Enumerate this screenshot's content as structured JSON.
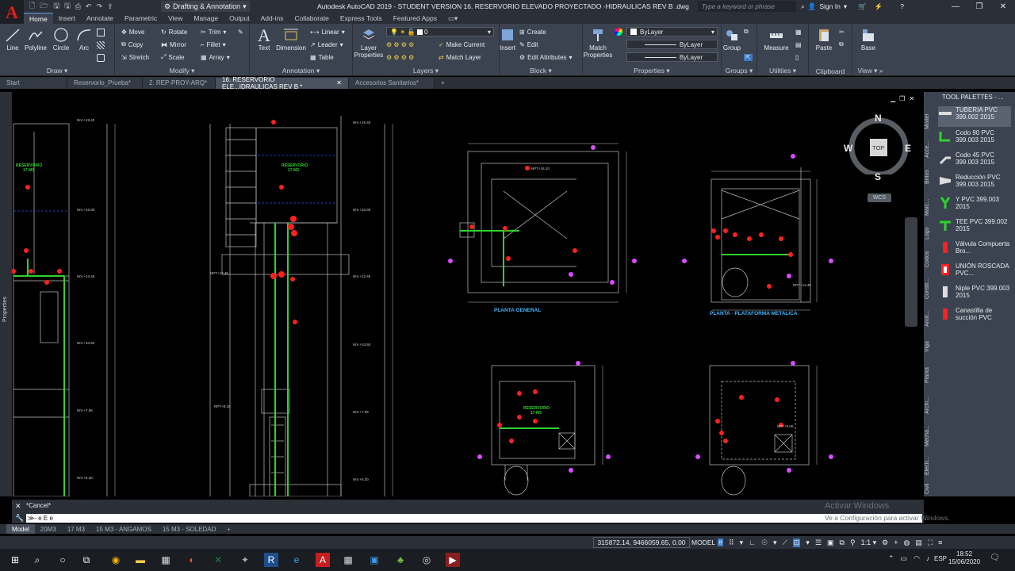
{
  "app": {
    "title": "Autodesk AutoCAD 2019 - STUDENT VERSION    16. RESERVORIO ELEVADO PROYECTADO -HIDRAULICAS REV B .dwg",
    "workspace": "Drafting & Annotation",
    "search_placeholder": "Type a keyword or phrase",
    "sign_in": "Sign In",
    "logo_letter": "A"
  },
  "menu_tabs": [
    "Home",
    "Insert",
    "Annotate",
    "Parametric",
    "View",
    "Manage",
    "Output",
    "Add-ins",
    "Collaborate",
    "Express Tools",
    "Featured Apps"
  ],
  "ribbon": {
    "draw": {
      "title": "Draw",
      "line": "Line",
      "polyline": "Polyline",
      "circle": "Circle",
      "arc": "Arc"
    },
    "modify": {
      "title": "Modify",
      "move": "Move",
      "rotate": "Rotate",
      "trim": "Trim",
      "copy": "Copy",
      "mirror": "Mirror",
      "fillet": "Fillet",
      "stretch": "Stretch",
      "scale": "Scale",
      "array": "Array"
    },
    "annotation": {
      "title": "Annotation",
      "text": "Text",
      "dimension": "Dimension",
      "linear": "Linear",
      "leader": "Leader",
      "table": "Table"
    },
    "layers": {
      "title": "Layers",
      "layer_properties": "Layer Properties",
      "current_layer": "0",
      "make_current": "Make Current",
      "match_layer": "Match Layer"
    },
    "block": {
      "title": "Block",
      "insert": "Insert",
      "create": "Create",
      "edit": "Edit",
      "edit_attributes": "Edit Attributes"
    },
    "properties": {
      "title": "Properties",
      "match_properties": "Match Properties",
      "bylayer1": "ByLayer",
      "bylayer2": "ByLayer",
      "bylayer3": "ByLayer"
    },
    "groups": {
      "title": "Groups",
      "group": "Group"
    },
    "utilities": {
      "title": "Utilities",
      "measure": "Measure"
    },
    "clipboard": {
      "title": "Clipboard",
      "paste": "Paste"
    },
    "view": {
      "title": "View",
      "base": "Base"
    }
  },
  "file_tabs": [
    "Start",
    "Reservorio_Prueba*",
    "2. REP-PROY-ARQ*",
    "16. RESERVORIO ELE...IDRAULICAS REV B *",
    "Accesorios Sanitarios*"
  ],
  "properties_label": "Properties",
  "viewcube": {
    "n": "N",
    "s": "S",
    "e": "E",
    "w": "W",
    "top": "TOP",
    "wcs": "WCS"
  },
  "drawing": {
    "planta_general": "PLANTA GENERAL",
    "planta_plataforma": "PLANTA - PLATAFORMA METALICA",
    "reservorio1": "RESERVORIO",
    "reservorio1_vol": "17 M3",
    "reservorio2": "RESERVORIO",
    "reservorio2_vol": "17 M3",
    "reservorio3": "RESERVORIO",
    "reservorio3_vol": "17 M3"
  },
  "tool_palette": {
    "title": "TOOL PALETTES - ...",
    "items": [
      "TUBERIA PVC 399.002 2015",
      "Codo 90 PVC 399.003 2015",
      "Codo 45 PVC 399.003 2015",
      "Reducción PVC 399.003.2015",
      "Y PVC 399.003 2015",
      "TEE PVC 399.002 2015",
      "Válvula Compuerta Bro...",
      "UNIÓN ROSCADA PVC...",
      "Niple PVC 399.003 2015",
      "Canastilla de succión PVC"
    ],
    "tabs": [
      "Model",
      "Acce...",
      "Britos",
      "Marc...",
      "Logo",
      "Codos",
      "Constr...",
      "Anot...",
      "Viga",
      "Planta",
      "Archi...",
      "Mecha...",
      "Electr...",
      "Civil"
    ]
  },
  "command": {
    "history": "*Cancel*",
    "input": "≫- e E e"
  },
  "layout_tabs": [
    "Model",
    "20M3",
    "17 M3",
    "15 M3 - ANGAMOS",
    "15 M3 - SOLEDAD"
  ],
  "status": {
    "coords": "315872.14, 9466059.65, 0.00",
    "model": "MODEL"
  },
  "watermark": {
    "line1": "Activar Windows",
    "line2": "Ve a Configuración para activar Windows."
  },
  "taskbar": {
    "lang": "ESP",
    "time": "18:52",
    "date": "15/06/2020"
  }
}
